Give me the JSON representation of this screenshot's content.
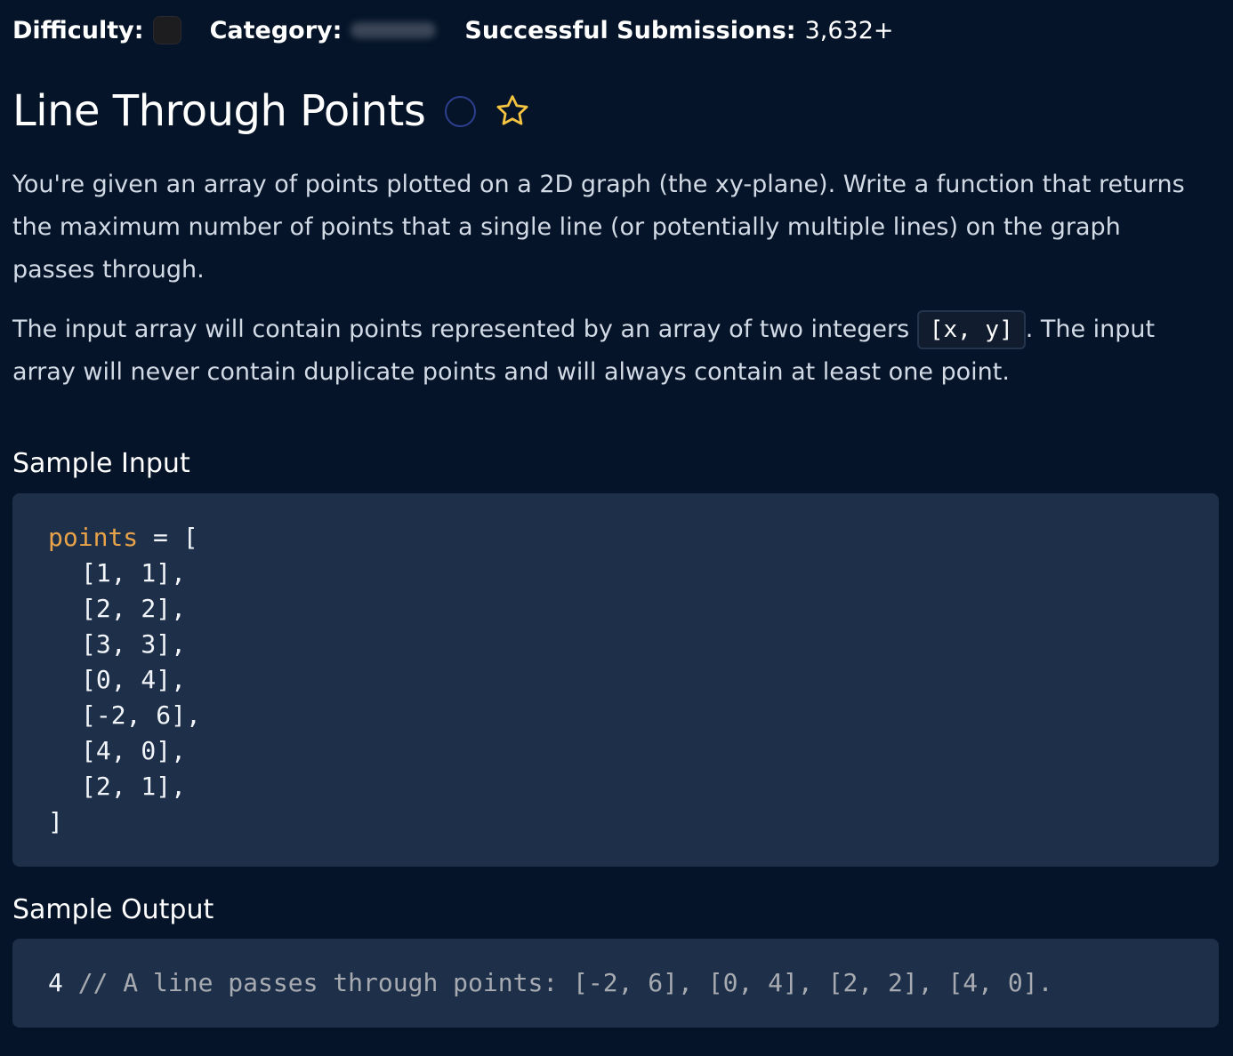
{
  "meta": {
    "difficulty_label": "Difficulty:",
    "category_label": "Category:",
    "submissions_label": "Successful Submissions:",
    "submissions_value": "3,632+"
  },
  "problem": {
    "title": "Line Through Points",
    "status_icon": "circle-outline-icon",
    "favorite_icon": "star-outline-icon",
    "colors": {
      "background": "#051428",
      "code_background": "#1e3049",
      "variable": "#e8a249",
      "star": "#f5c542",
      "status_circle": "#2d3f8f"
    },
    "paragraph_1": "You're given an array of points plotted on a 2D graph (the xy-plane). Write a function that returns the maximum number of points that a single line (or potentially multiple lines) on the graph passes through.",
    "paragraph_2_before": "The input array will contain points represented by an array of two integers ",
    "paragraph_2_code": "[x, y]",
    "paragraph_2_after": ". The input array will never contain duplicate points and will always contain at least one point."
  },
  "sample_input": {
    "heading": "Sample Input",
    "variable": "points",
    "assign": " = [",
    "lines": [
      "[1, 1],",
      "[2, 2],",
      "[3, 3],",
      "[0, 4],",
      "[-2, 6],",
      "[4, 0],",
      "[2, 1],"
    ],
    "closing": "]"
  },
  "sample_output": {
    "heading": "Sample Output",
    "value": "4",
    "comment": " // A line passes through points: [-2, 6], [0, 4], [2, 2], [4, 0]."
  }
}
